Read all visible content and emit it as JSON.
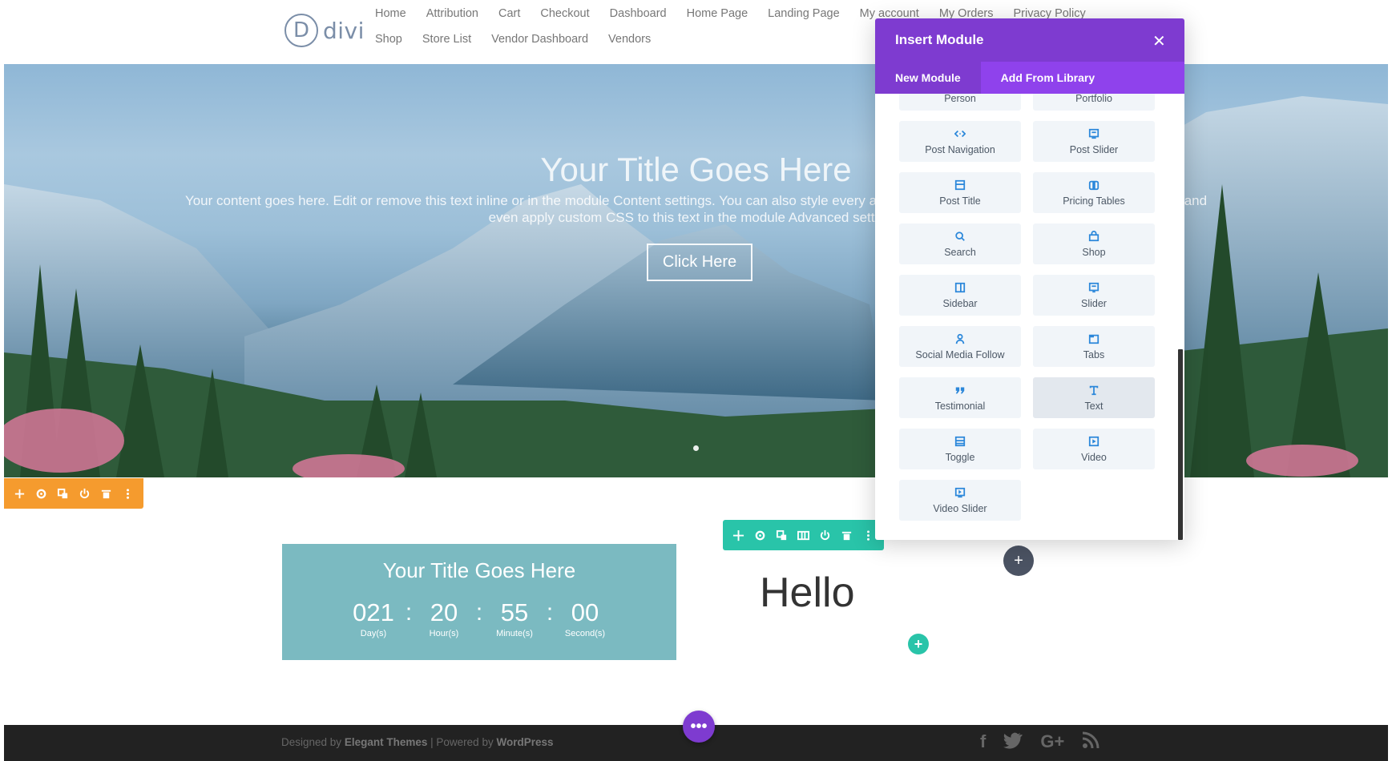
{
  "logo": {
    "mark": "D",
    "text": "divi"
  },
  "nav": {
    "items": [
      "Home",
      "Attribution",
      "Cart",
      "Checkout",
      "Dashboard",
      "Home Page",
      "Landing Page",
      "My account",
      "My Orders",
      "Privacy Policy",
      "Shop",
      "Store List",
      "Vendor Dashboard",
      "Vendors"
    ]
  },
  "hero": {
    "title": "Your Title Goes Here",
    "body": "Your content goes here. Edit or remove this text inline or in the module Content settings. You can also style every aspect of this content in the module Design settings and even apply custom CSS to this text in the module Advanced settings.",
    "button_label": "Click Here"
  },
  "countdown": {
    "title": "Your Title Goes Here",
    "days": "021",
    "days_label": "Day(s)",
    "hours": "20",
    "hours_label": "Hour(s)",
    "minutes": "55",
    "minutes_label": "Minute(s)",
    "seconds": "00",
    "seconds_label": "Second(s)",
    "separator": ":"
  },
  "hello_text": "Hello",
  "footer": {
    "designed_by": "Designed by",
    "designer": "Elegant Themes",
    "divider": "|",
    "powered_by": "Powered by",
    "platform": "WordPress",
    "social": [
      "f",
      "t",
      "G+",
      "rss"
    ]
  },
  "modal": {
    "title": "Insert Module",
    "close": "✕",
    "tabs": [
      "New Module",
      "Add From Library"
    ],
    "modules": [
      {
        "label": "Person",
        "icon": "person-icon"
      },
      {
        "label": "Portfolio",
        "icon": "portfolio-icon"
      },
      {
        "label": "Post Navigation",
        "icon": "post-navigation-icon"
      },
      {
        "label": "Post Slider",
        "icon": "post-slider-icon"
      },
      {
        "label": "Post Title",
        "icon": "post-title-icon"
      },
      {
        "label": "Pricing Tables",
        "icon": "pricing-tables-icon"
      },
      {
        "label": "Search",
        "icon": "search-icon"
      },
      {
        "label": "Shop",
        "icon": "shop-icon"
      },
      {
        "label": "Sidebar",
        "icon": "sidebar-icon"
      },
      {
        "label": "Slider",
        "icon": "slider-icon"
      },
      {
        "label": "Social Media Follow",
        "icon": "social-follow-icon"
      },
      {
        "label": "Tabs",
        "icon": "tabs-icon"
      },
      {
        "label": "Testimonial",
        "icon": "testimonial-icon"
      },
      {
        "label": "Text",
        "icon": "text-icon"
      },
      {
        "label": "Toggle",
        "icon": "toggle-icon"
      },
      {
        "label": "Video",
        "icon": "video-icon"
      },
      {
        "label": "Video Slider",
        "icon": "video-slider-icon"
      }
    ]
  },
  "colors": {
    "divi_purple": "#7e3bd0",
    "tab_purple": "#8f42ec",
    "section_orange": "#f59b2e",
    "row_green": "#29c4a9",
    "countdown_teal": "#7bbac1",
    "module_icon_blue": "#2b87da",
    "footer_dark": "#222222"
  }
}
